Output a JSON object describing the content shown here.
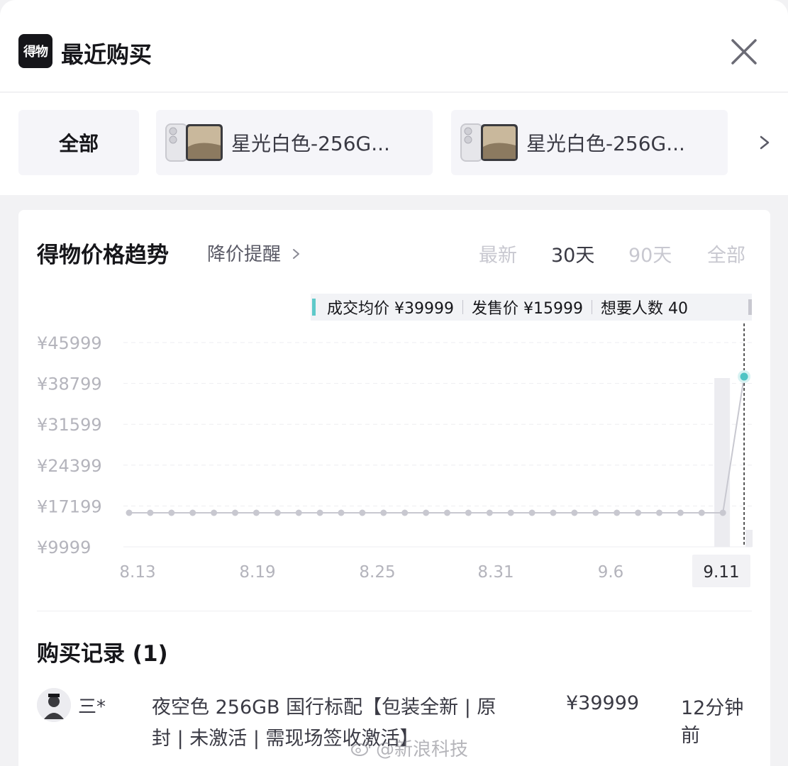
{
  "header": {
    "logo_text": "得物",
    "title": "最近购买"
  },
  "filters": {
    "all_label": "全部",
    "products": [
      {
        "label": "星光白色-256G..."
      },
      {
        "label": "星光白色-256G..."
      }
    ]
  },
  "trend": {
    "title": "得物价格趋势",
    "alert_label": "降价提醒",
    "ranges": [
      "最新",
      "30天",
      "90天",
      "全部"
    ],
    "active_range": "30天",
    "tooltip": {
      "avg_price": "成交均价 ¥39999",
      "release_price": "发售价 ¥15999",
      "wanted": "想要人数 40"
    }
  },
  "chart_data": {
    "type": "line",
    "title": "",
    "xlabel": "",
    "ylabel": "",
    "y_ticks": [
      "¥45999",
      "¥38799",
      "¥31599",
      "¥24399",
      "¥17199",
      "¥9999"
    ],
    "ylim": [
      9999,
      45999
    ],
    "x_tick_labels": [
      "8.13",
      "8.19",
      "8.25",
      "8.31",
      "9.6",
      "9.11"
    ],
    "highlighted_x": "9.11",
    "series": [
      {
        "values": [
          15999,
          15999,
          15999,
          15999,
          15999,
          15999,
          15999,
          15999,
          15999,
          15999,
          15999,
          15999,
          15999,
          15999,
          15999,
          15999,
          15999,
          15999,
          15999,
          15999,
          15999,
          15999,
          15999,
          15999,
          15999,
          15999,
          15999,
          15999,
          15999,
          39999
        ]
      }
    ],
    "grid": true,
    "colors": {
      "line": "#c8c8d0",
      "highlight_point": "#4fc4c4"
    }
  },
  "records": {
    "title": "购买记录 (1)",
    "items": [
      {
        "user": "三*",
        "spec": "夜空色 256GB 国行标配【包装全新 | 原封 | 未激活 | 需现场签收激活】",
        "price": "¥39999",
        "time": "12分钟前"
      }
    ]
  },
  "watermark": "@新浪科技"
}
